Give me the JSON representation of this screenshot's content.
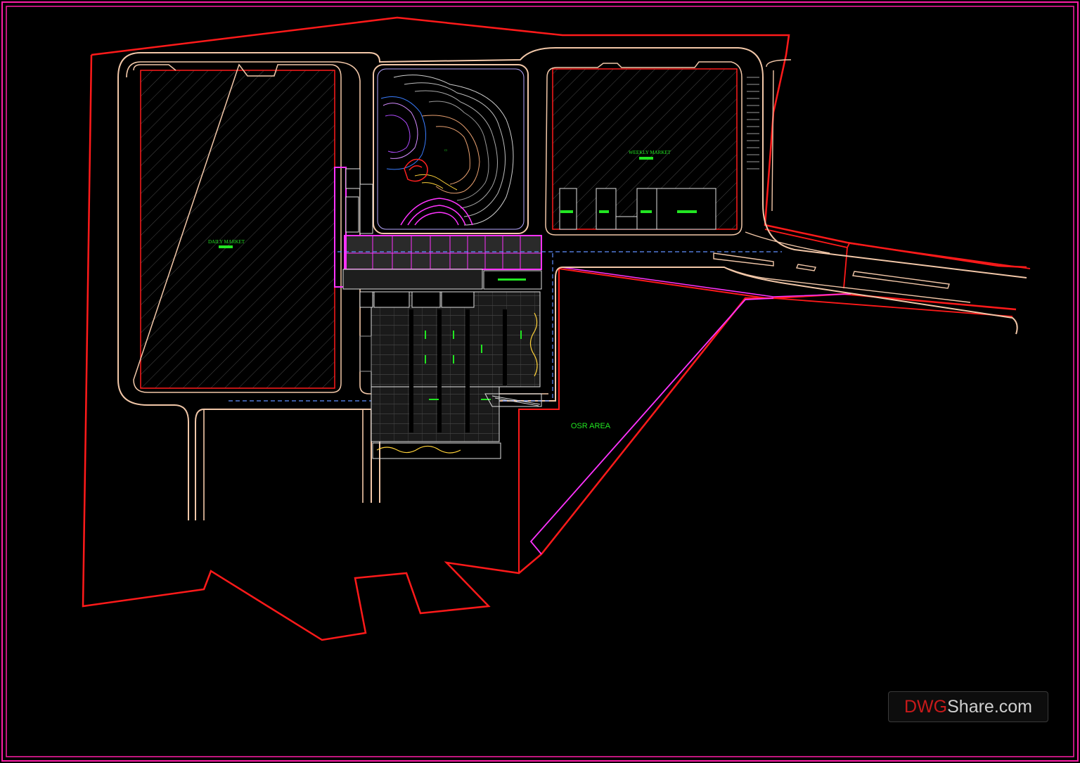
{
  "drawing": {
    "labels": {
      "daily_market": "DAILY MARKET",
      "weekly_market": "WEEKLY MARKET",
      "osr_area": "OSR AREA"
    },
    "colors": {
      "background": "#000000",
      "frame": "#ff1ea8",
      "boundary": "#ff1a1a",
      "road": "#f2c7a8",
      "text_green": "#22e622",
      "magenta": "#ff33ff",
      "dash_blue": "#5f8fff"
    }
  },
  "watermark": {
    "prefix": "DWG",
    "suffix": "Share.com"
  }
}
